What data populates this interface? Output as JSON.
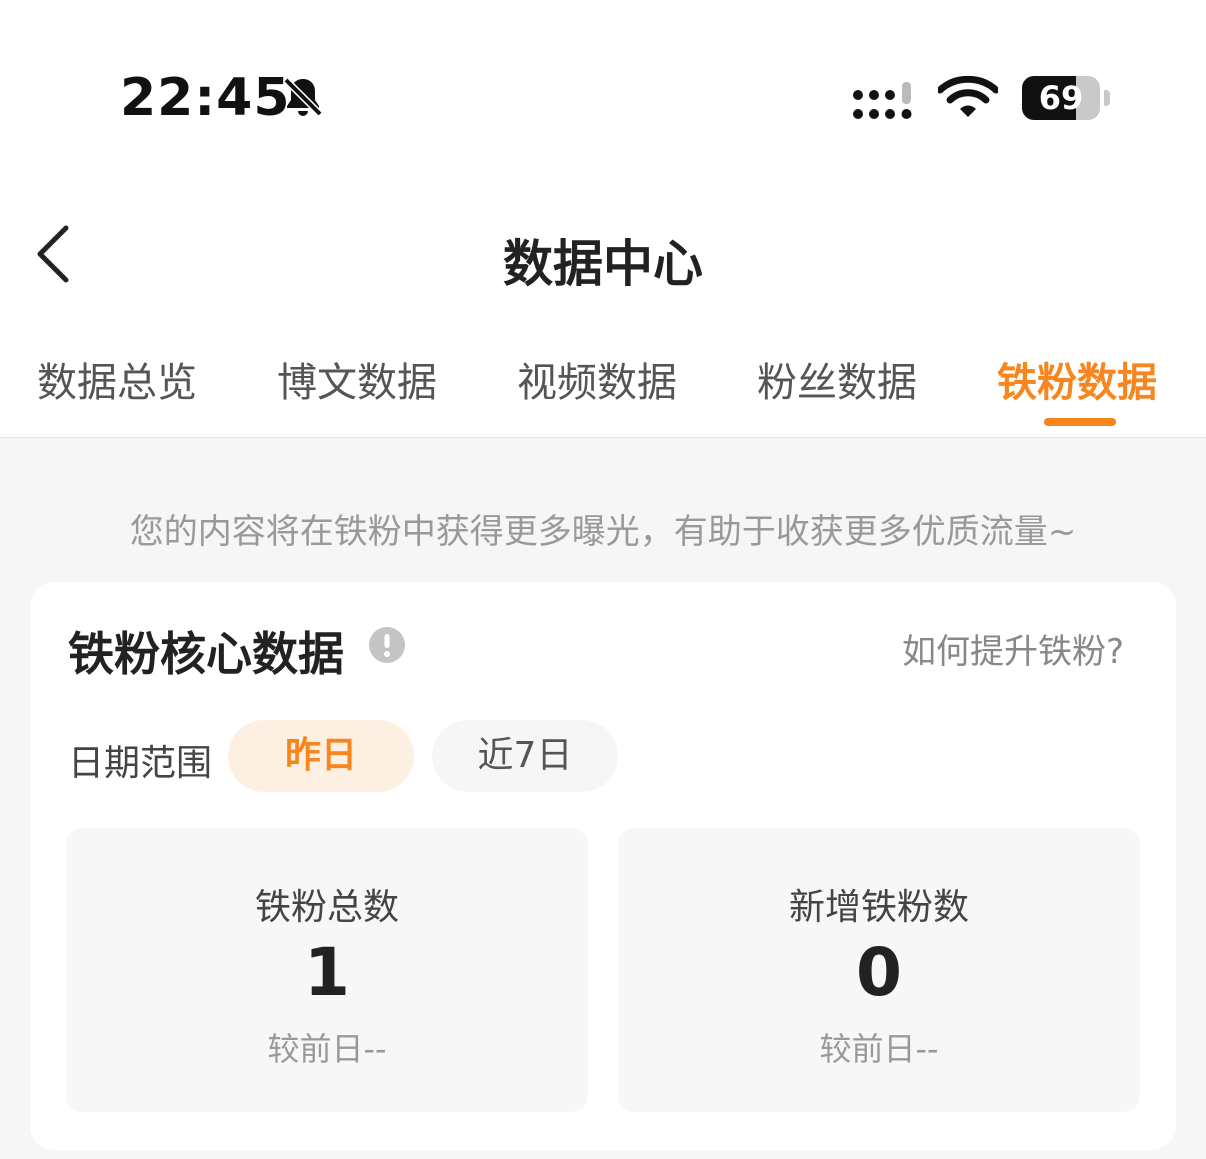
{
  "status_bar": {
    "time": "22:45",
    "battery": "69",
    "battery_level": 0.69
  },
  "header": {
    "title": "数据中心"
  },
  "tabs": [
    {
      "label": "数据总览"
    },
    {
      "label": "博文数据"
    },
    {
      "label": "视频数据"
    },
    {
      "label": "粉丝数据"
    },
    {
      "label": "铁粉数据",
      "active": true
    }
  ],
  "tip": "您的内容将在铁粉中获得更多曝光，有助于收获更多优质流量~",
  "core_card": {
    "title": "铁粉核心数据",
    "help_link": "如何提升铁粉?",
    "date_range_label": "日期范围",
    "chips": [
      "昨日",
      "近7日"
    ],
    "stats": [
      {
        "label": "铁粉总数",
        "value": "1",
        "compare": "较前日--"
      },
      {
        "label": "新增铁粉数",
        "value": "0",
        "compare": "较前日--"
      }
    ]
  },
  "colors": {
    "accent": "#f7861e",
    "chip_active_bg": "#fdf0e2",
    "background": "#f6f6f6"
  },
  "icons": [
    "bell-muted-icon",
    "signal-icon",
    "wifi-icon",
    "battery-icon",
    "back-chevron-icon",
    "info-icon"
  ]
}
